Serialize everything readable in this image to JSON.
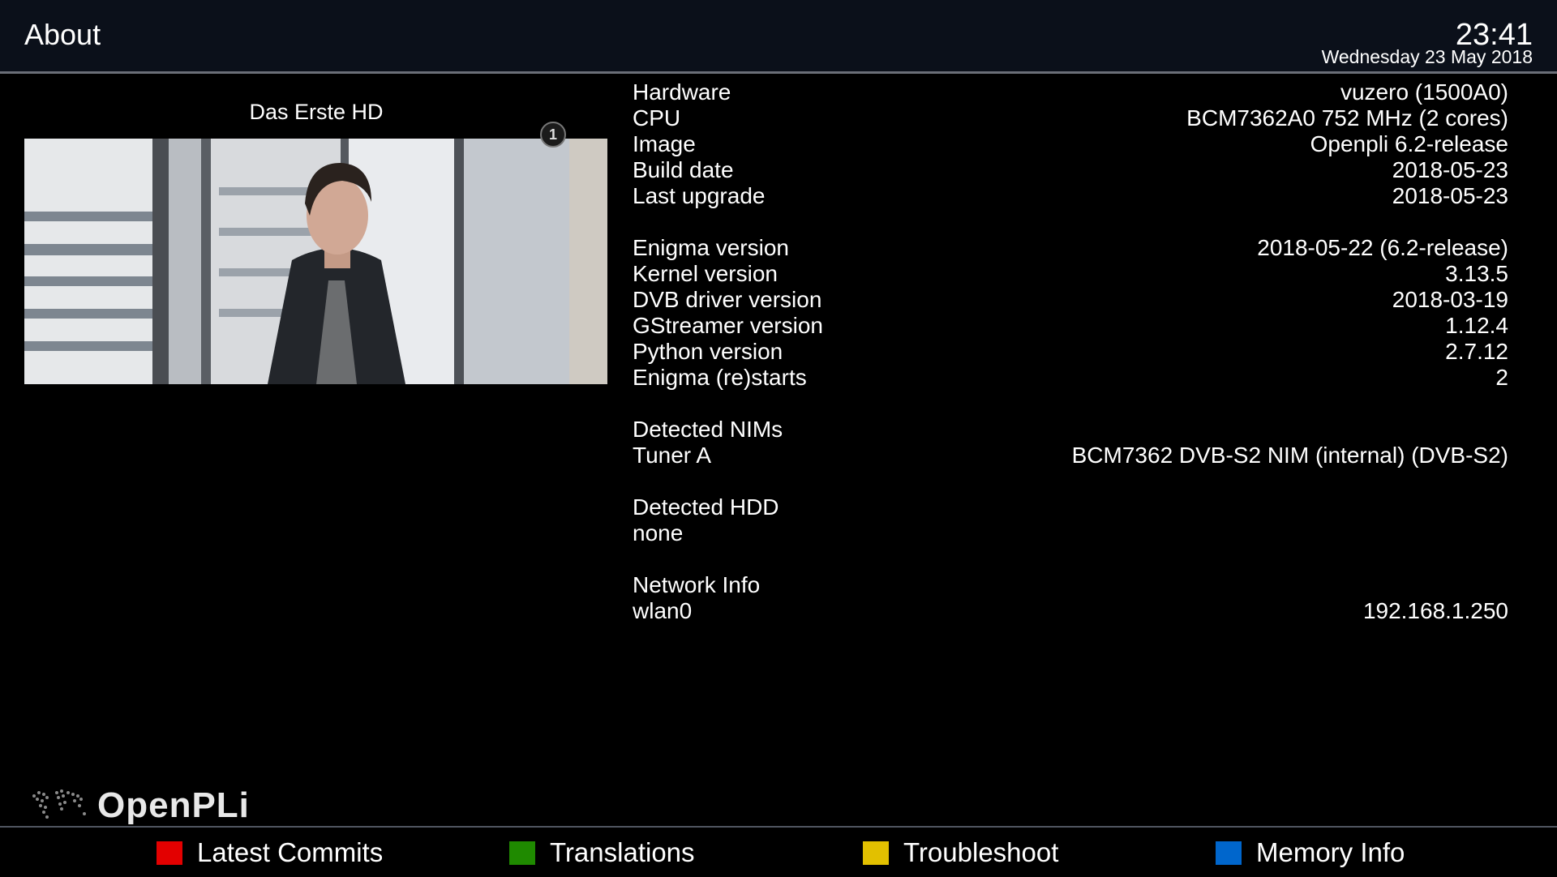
{
  "header": {
    "title": "About",
    "clock": "23:41",
    "date": "Wednesday 23 May 2018"
  },
  "pip": {
    "channel": "Das Erste HD",
    "logo_icon": "das-erste-logo-icon"
  },
  "info": {
    "hardware_label": "Hardware",
    "hardware_value": "vuzero (1500A0)",
    "cpu_label": "CPU",
    "cpu_value": "BCM7362A0 752 MHz (2 cores)",
    "image_label": "Image",
    "image_value": "Openpli 6.2-release",
    "build_label": "Build date",
    "build_value": "2018-05-23",
    "upgrade_label": "Last upgrade",
    "upgrade_value": "2018-05-23",
    "enigma_label": "Enigma version",
    "enigma_value": "2018-05-22 (6.2-release)",
    "kernel_label": "Kernel version",
    "kernel_value": "3.13.5",
    "dvb_label": "DVB driver version",
    "dvb_value": "2018-03-19",
    "gst_label": "GStreamer version",
    "gst_value": "1.12.4",
    "python_label": "Python version",
    "python_value": "2.7.12",
    "restarts_label": "Enigma (re)starts",
    "restarts_value": "2",
    "nims_heading": "Detected NIMs",
    "tuner_label": "Tuner A",
    "tuner_value": "BCM7362 DVB-S2 NIM (internal) (DVB-S2)",
    "hdd_heading": "Detected HDD",
    "hdd_value": "none",
    "network_heading": "Network Info",
    "iface_label": "wlan0",
    "iface_value": "192.168.1.250"
  },
  "brand": {
    "name": "OpenPLi"
  },
  "footer": {
    "red": "Latest Commits",
    "green": "Translations",
    "yellow": "Troubleshoot",
    "blue": "Memory Info"
  },
  "colors": {
    "red": "#e30000",
    "green": "#1f8a00",
    "yellow": "#e2c000",
    "blue": "#0066cc",
    "header_bg": "#0b101a"
  }
}
